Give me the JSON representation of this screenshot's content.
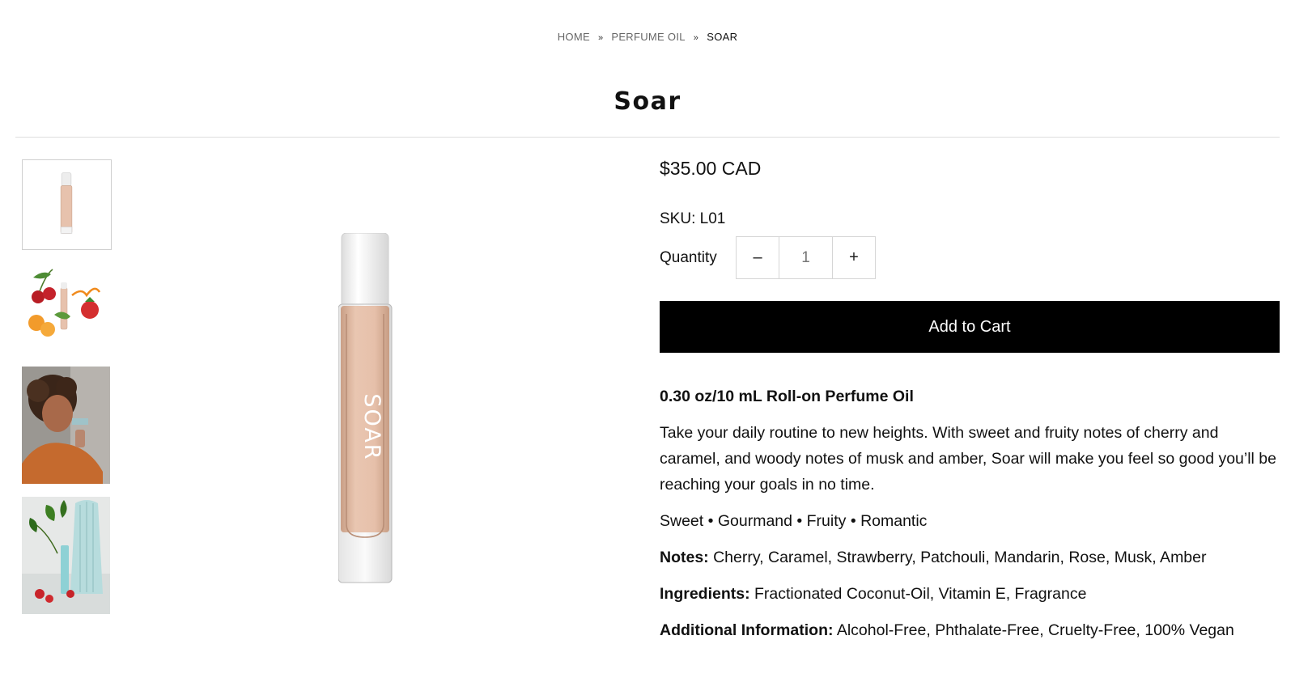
{
  "breadcrumb": {
    "home": "HOME",
    "sep1": "»",
    "category": "PERFUME OIL",
    "sep2": "»",
    "current": "SOAR"
  },
  "product": {
    "title": "Soar",
    "price": "$35.00 CAD",
    "sku": "SKU: L01",
    "quantity_label": "Quantity",
    "quantity_value": "1",
    "minus": "–",
    "plus": "+",
    "add_to_cart": "Add to Cart",
    "size_line": "0.30 oz/10 mL Roll-on Perfume Oil",
    "description": "Take your daily routine to new heights. With sweet and fruity notes of cherry and caramel, and woody notes of musk and amber, Soar will make you feel so good you’ll be reaching your goals in no time.",
    "tags": "Sweet • Gourmand • Fruity • Romantic",
    "notes_label": "Notes:",
    "notes": " Cherry, Caramel, Strawberry, Patchouli, Mandarin, Rose, Musk, Amber",
    "ingredients_label": "Ingredients:",
    "ingredients": " Fractionated Coconut-Oil, Vitamin E, Fragrance",
    "additional_label": "Additional Information:",
    "additional": " Alcohol-Free, Phthalate-Free, Cruelty-Free, 100% Vegan",
    "bottle_label": "SOAR"
  },
  "colors": {
    "accent": "#000000",
    "oil": "#e7c2ad",
    "divider": "#dedede"
  }
}
